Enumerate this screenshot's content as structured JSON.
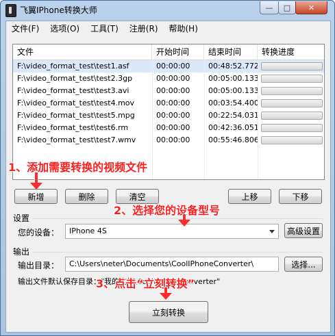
{
  "window": {
    "title": "飞翼IPhone转换大师",
    "minimize_glyph": "—",
    "maximize_glyph": "□",
    "close_glyph": "✕"
  },
  "menu": [
    "文件(F)",
    "选项(O)",
    "工具(T)",
    "注册(R)",
    "帮助(H)"
  ],
  "table": {
    "headers": [
      "文件",
      "开始时间",
      "结束时间",
      "转换进度"
    ],
    "rows": [
      {
        "file": "F:\\video_format_test\\test1.asf",
        "start": "00:00:00",
        "end": "00:48:52.772",
        "progress": 0,
        "selected": true
      },
      {
        "file": "F:\\video_format_test\\test2.3gp",
        "start": "00:00:00",
        "end": "00:05:00.133",
        "progress": 0,
        "selected": false
      },
      {
        "file": "F:\\video_format_test\\test3.avi",
        "start": "00:00:00",
        "end": "00:05:00.133",
        "progress": 0,
        "selected": false
      },
      {
        "file": "F:\\video_format_test\\test4.mov",
        "start": "00:00:00",
        "end": "00:03:54.400",
        "progress": 0,
        "selected": false
      },
      {
        "file": "F:\\video_format_test\\test5.mpg",
        "start": "00:00:00",
        "end": "00:22:54.031",
        "progress": 0,
        "selected": false
      },
      {
        "file": "F:\\video_format_test\\test6.rm",
        "start": "00:00:00",
        "end": "00:42:36.051",
        "progress": 0,
        "selected": false
      },
      {
        "file": "F:\\video_format_test\\test7.wmv",
        "start": "00:00:00",
        "end": "00:55:46.806",
        "progress": 0,
        "selected": false
      }
    ]
  },
  "buttons": {
    "add": "新增",
    "delete": "删除",
    "clear": "清空",
    "move_up": "上移",
    "move_down": "下移",
    "advanced": "高级设置",
    "browse": "选择...",
    "convert": "立刻转换"
  },
  "settings": {
    "group_label": "设置",
    "device_label": "您的设备：",
    "device_value": "IPhone 4S"
  },
  "output": {
    "group_label": "输出",
    "dir_label": "输出目录：",
    "dir_value": "C:\\Users\\neter\\Documents\\CoolIPhoneConverter\\",
    "note_text": "输出文件默认保存目录：\"我的文档\\CoolIPhoneConverter\""
  },
  "annotations": {
    "step1": "1、添加需要转换的视频文件",
    "step2": "2、选择您的设备型号",
    "step3": "3、点击“立刻转换”"
  },
  "colors": {
    "annotation": "#ff1e1e",
    "progress_fill": "#37b337",
    "selection": "#dbe9fb"
  }
}
